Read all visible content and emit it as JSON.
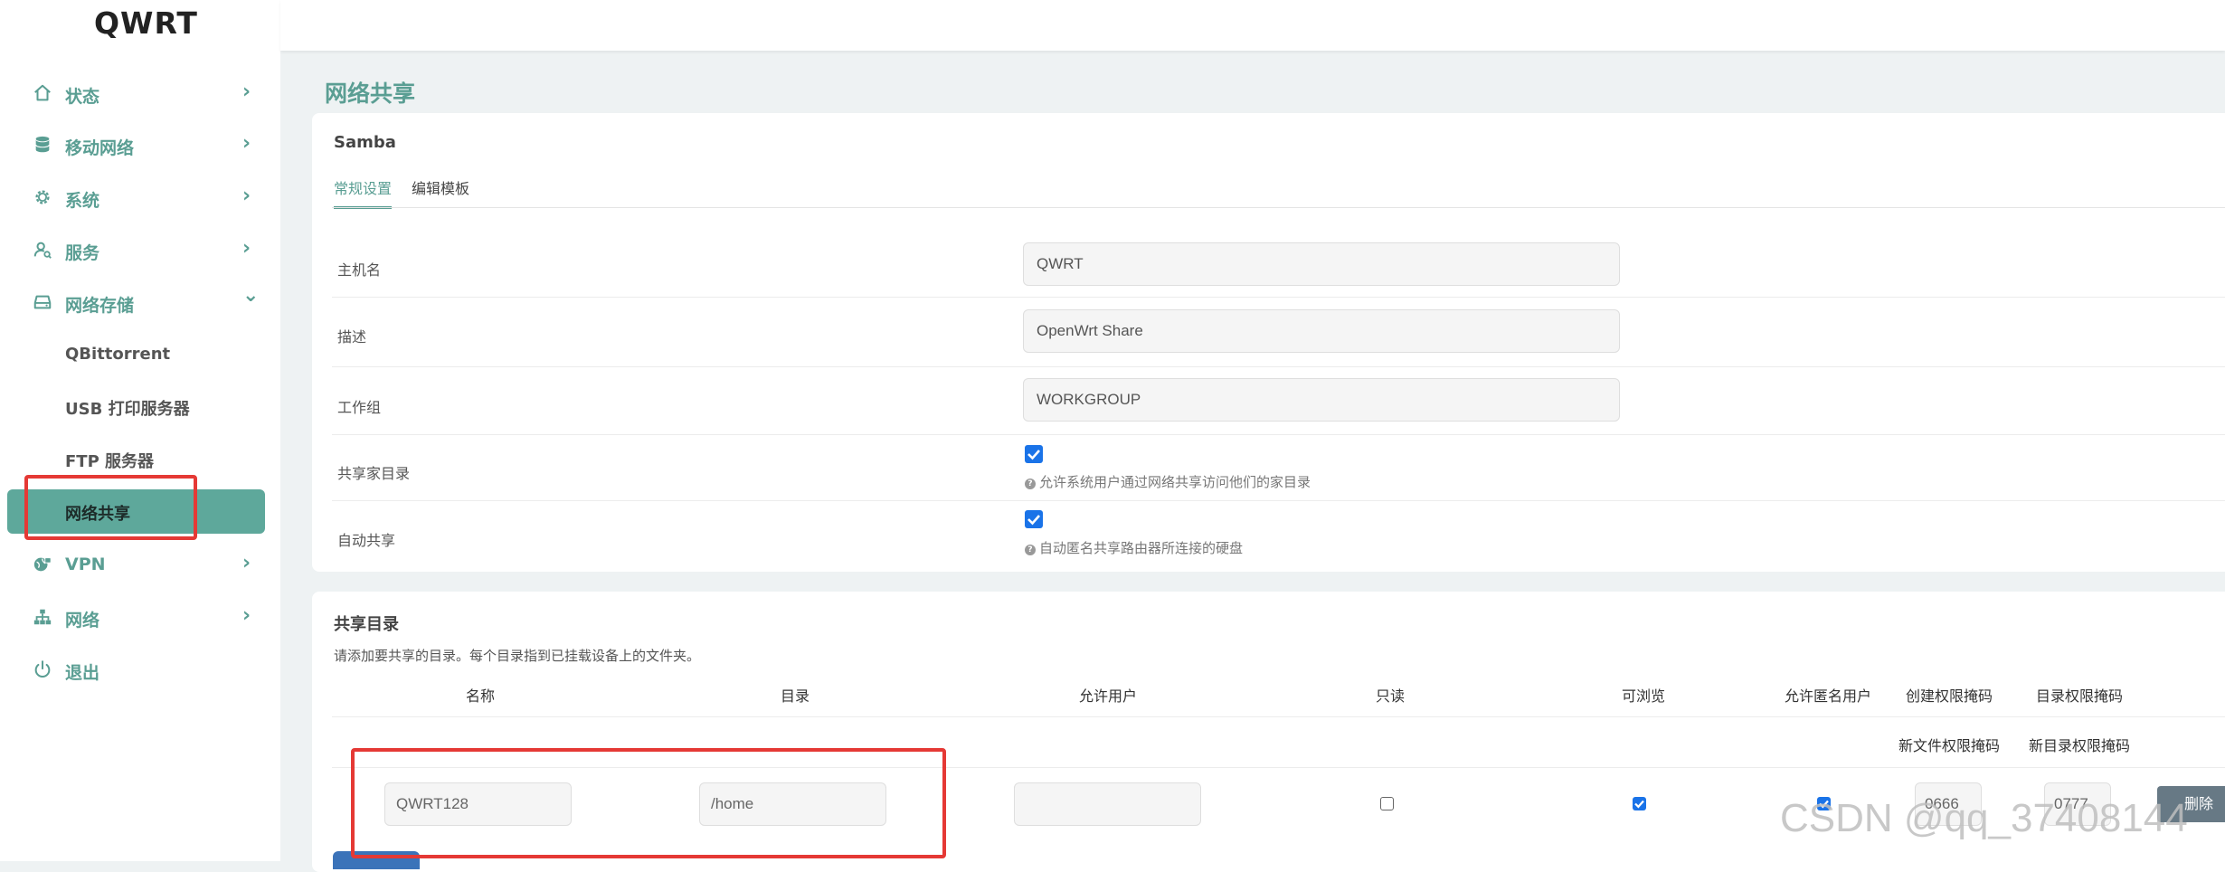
{
  "brand": "QWRT",
  "sidebar": {
    "items": [
      {
        "label": "状态",
        "icon": "home-icon",
        "chevron": "›"
      },
      {
        "label": "移动网络",
        "icon": "database-icon",
        "chevron": "›"
      },
      {
        "label": "系统",
        "icon": "gear-icon",
        "chevron": "›"
      },
      {
        "label": "服务",
        "icon": "user-service-icon",
        "chevron": "›"
      },
      {
        "label": "网络存储",
        "icon": "hard-drive-icon",
        "chevron": "⌄"
      },
      {
        "label": "VPN",
        "icon": "globe-lock-icon",
        "chevron": "›"
      },
      {
        "label": "网络",
        "icon": "network-icon",
        "chevron": "›"
      },
      {
        "label": "退出",
        "icon": "power-icon",
        "chevron": ""
      }
    ],
    "sub_items": [
      {
        "label": "QBittorrent"
      },
      {
        "label": "USB 打印服务器"
      },
      {
        "label": "FTP 服务器"
      },
      {
        "label": "网络共享",
        "active": true
      }
    ]
  },
  "page": {
    "title": "网络共享"
  },
  "samba": {
    "title": "Samba",
    "tabs": [
      "常规设置",
      "编辑模板"
    ],
    "active_tab": "常规设置",
    "fields": {
      "hostname": {
        "label": "主机名",
        "value": "QWRT"
      },
      "description": {
        "label": "描述",
        "value": "OpenWrt Share"
      },
      "workgroup": {
        "label": "工作组",
        "value": "WORKGROUP"
      },
      "share_homes": {
        "label": "共享家目录",
        "checked": true,
        "hint": "允许系统用户通过网络共享访问他们的家目录"
      },
      "auto_share": {
        "label": "自动共享",
        "checked": true,
        "hint": "自动匿名共享路由器所连接的硬盘"
      }
    }
  },
  "shares": {
    "title": "共享目录",
    "description": "请添加要共享的目录。每个目录指到已挂载设备上的文件夹。",
    "columns": {
      "name": "名称",
      "path": "目录",
      "users": "允许用户",
      "readonly": "只读",
      "browseable": "可浏览",
      "guest": "允许匿名用户",
      "create_mask": "创建权限掩码",
      "dir_mask": "目录权限掩码",
      "create_mask_sub": "新文件权限掩码",
      "dir_mask_sub": "新目录权限掩码"
    },
    "rows": [
      {
        "name": "QWRT128",
        "path": "/home",
        "users": "",
        "readonly": false,
        "browseable": true,
        "guest": true,
        "create_mask": "0666",
        "dir_mask": "0777",
        "delete_label": "删除"
      }
    ]
  },
  "watermark": "CSDN @qq_37408144",
  "colors": {
    "accent": "#5a9e93",
    "active_bg": "#5ea89b",
    "highlight_box": "#e53935",
    "checkbox": "#1a73e8",
    "delete_btn": "#677985"
  }
}
